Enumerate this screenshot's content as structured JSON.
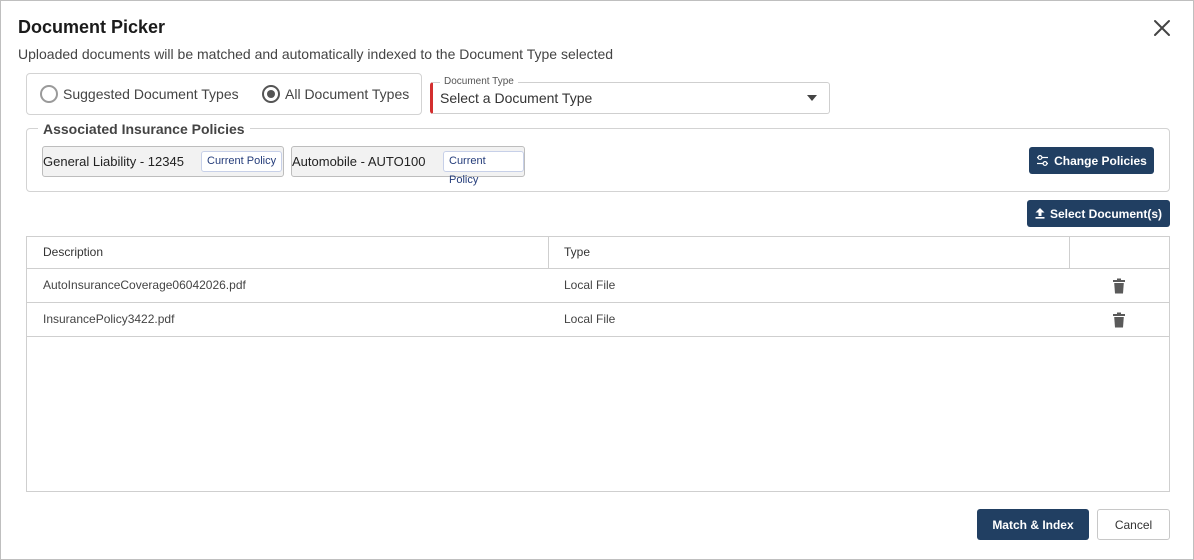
{
  "dialog": {
    "title": "Document Picker",
    "subtitle": "Uploaded documents will be matched and automatically indexed to the Document Type selected"
  },
  "radios": {
    "suggested_label": "Suggested Document Types",
    "all_label": "All Document Types",
    "selected": "all"
  },
  "document_type": {
    "legend": "Document Type",
    "value": "Select a Document Type"
  },
  "policies": {
    "legend": "Associated Insurance Policies",
    "items": [
      {
        "name": "General Liability - 12345",
        "badge": "Current Policy"
      },
      {
        "name": "Automobile - AUTO100",
        "badge": "Current Policy"
      }
    ],
    "change_button": "Change Policies"
  },
  "select_documents_button": "Select Document(s)",
  "table": {
    "headers": [
      "Description",
      "Type",
      ""
    ],
    "rows": [
      {
        "description": "AutoInsuranceCoverage06042026.pdf",
        "type": "Local File"
      },
      {
        "description": "InsurancePolicy3422.pdf",
        "type": "Local File"
      }
    ]
  },
  "footer": {
    "match_button": "Match & Index",
    "cancel_button": "Cancel"
  },
  "colors": {
    "primary": "#213f62",
    "required_accent": "#d32f2f",
    "badge_text": "#243c7a"
  },
  "icons": [
    "close-icon",
    "sliders-icon",
    "upload-icon",
    "trash-icon"
  ]
}
